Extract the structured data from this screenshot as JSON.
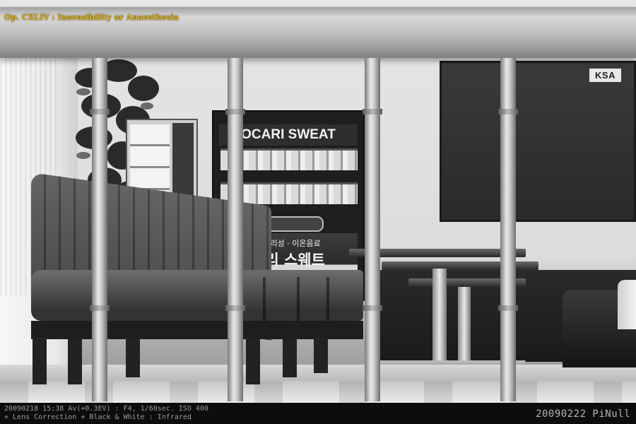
{
  "photo": {
    "caption": "Op. CXLIV : Insensibility or Anaesthesia",
    "caption_color": "#e0b000",
    "exif_line1": "20090218 15:38 Av(+0.3EV) : F4, 1/60sec. ISO 400",
    "exif_line2": "+ Lens Correction + Black & White : Infrared",
    "signature": "20090222 PiNull"
  },
  "scene": {
    "vending_machine_brand": "OCARI SWEAT",
    "vending_korean_small": "알칼리성 · 이온음료",
    "vending_korean_large": "카리 스웨트",
    "wall_sign": "KSA"
  }
}
